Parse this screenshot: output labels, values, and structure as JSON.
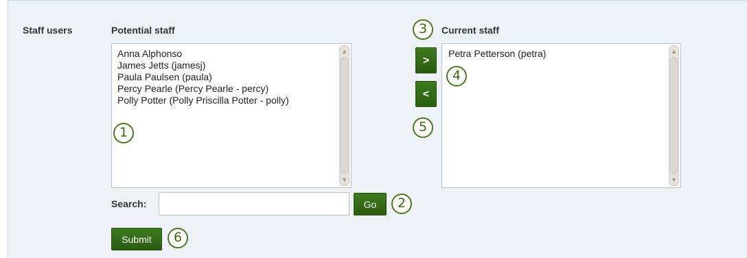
{
  "form": {
    "section_label": "Staff users",
    "potential": {
      "label": "Potential staff",
      "items": [
        "Anna Alphonso",
        "James Jetts (jamesj)",
        "Paula Paulsen (paula)",
        "Percy Pearle (Percy Pearle - percy)",
        "Polly Potter (Polly Priscilla Potter - polly)"
      ]
    },
    "current": {
      "label": "Current staff",
      "items": [
        "Petra Petterson (petra)"
      ]
    },
    "add_button_label": ">",
    "remove_button_label": "<",
    "search": {
      "label": "Search:",
      "value": "",
      "placeholder": "",
      "go_label": "Go"
    },
    "submit_label": "Submit"
  },
  "callouts": [
    "1",
    "2",
    "3",
    "4",
    "5",
    "6"
  ],
  "colors": {
    "panel_bg": "#eef2f7",
    "button_green": "#2f6514",
    "callout_green": "#4d7a1d"
  },
  "icons": {
    "scroll_up": "scroll-up-arrow-icon",
    "scroll_down": "scroll-down-arrow-icon"
  }
}
